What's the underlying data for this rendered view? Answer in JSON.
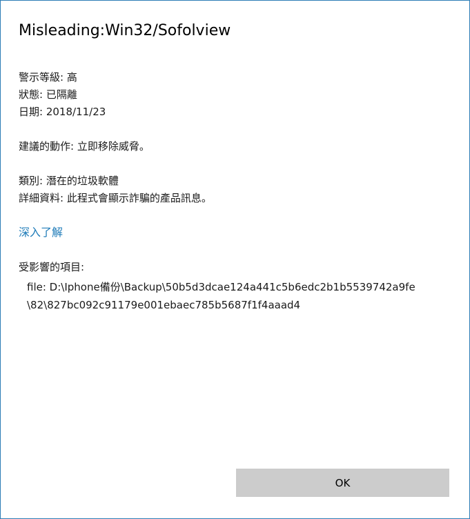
{
  "dialog": {
    "title": "Misleading:Win32/Sofolview",
    "alert_level": "警示等級: 高",
    "status": "狀態: 已隔離",
    "date": "日期:  2018/11/23",
    "recommended_action": "建議的動作: 立即移除威脅。",
    "category": "類別: 潛在的垃圾軟體",
    "details": "詳細資料: 此程式會顯示詐騙的產品訊息。",
    "learn_more_link": "深入了解",
    "affected_items_label": "受影響的項目:",
    "affected_items": [
      "file: D:\\Iphone備份\\Backup\\50b5d3dcae124a441c5b6edc2b1b5539742a9fe",
      "\\82\\827bc092c91179e001ebaec785b5687f1f4aaad4"
    ],
    "ok_button": "OK",
    "accent_color": "#1e7bb8",
    "border_color": "#2b7cb5"
  }
}
